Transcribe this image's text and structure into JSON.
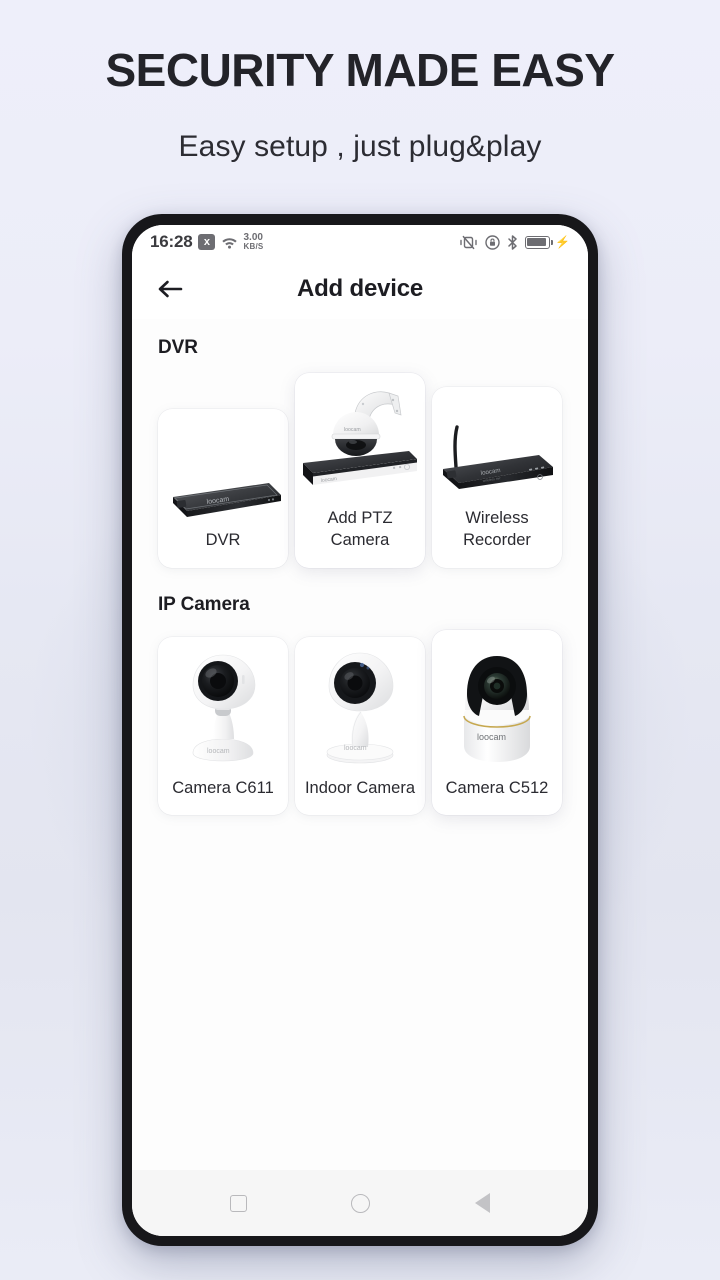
{
  "marketing": {
    "headline": "SECURITY MADE EASY",
    "subheadline": "Easy setup , just plug&play"
  },
  "colors": {
    "page_background": "#eceef9",
    "phone_frame": "#17171a",
    "screen_background": "#ffffff",
    "card_background": "#ffffff",
    "text_primary": "#1d1d22",
    "text_secondary": "#2b2b31",
    "status_icon": "#6d6d72",
    "nav_icon": "#b9b9bc"
  },
  "status_bar": {
    "clock": "16:28",
    "x_badge": "x",
    "network_speed_value": "3.00",
    "network_speed_unit": "KB/S",
    "icons_left": [
      "clock",
      "x-badge-icon",
      "wifi-icon",
      "network-speed"
    ],
    "icons_right": [
      "vibrate-mute-icon",
      "rotation-lock-icon",
      "bluetooth-icon",
      "battery-icon",
      "charging-bolt-icon"
    ]
  },
  "header": {
    "back_icon": "arrow-left-icon",
    "title": "Add device"
  },
  "sections": [
    {
      "title": "DVR",
      "items": [
        {
          "label": "DVR",
          "thumb": "dvr-recorder-image",
          "raised": false
        },
        {
          "label": "Add PTZ Camera",
          "thumb": "ptz-camera-and-recorder-image",
          "raised": true
        },
        {
          "label": "Wireless Recorder",
          "thumb": "wireless-recorder-image",
          "raised": false
        }
      ]
    },
    {
      "title": "IP Camera",
      "items": [
        {
          "label": "Camera C611",
          "thumb": "camera-c611-image",
          "raised": false
        },
        {
          "label": "Indoor Camera",
          "thumb": "indoor-camera-image",
          "raised": false
        },
        {
          "label": "Camera C512",
          "thumb": "camera-c512-image",
          "raised": true
        }
      ]
    }
  ],
  "brand_mark": "loocam",
  "nav_bar": {
    "recents_label": "Recents",
    "home_label": "Home",
    "back_label": "Back"
  }
}
